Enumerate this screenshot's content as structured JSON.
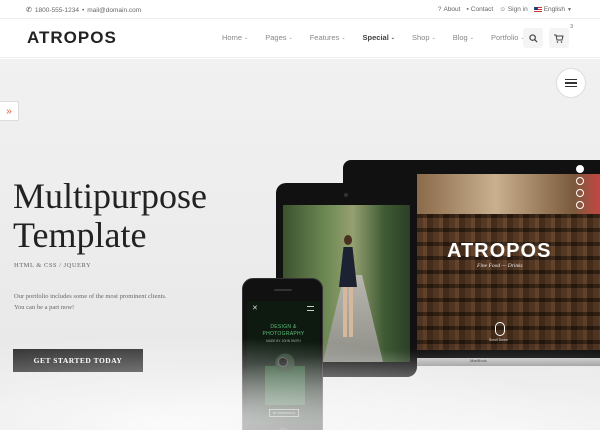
{
  "topbar": {
    "phone": "1800-555-1234",
    "separator": "•",
    "email": "mail@domain.com",
    "links": [
      {
        "label": "About",
        "icon": "question-icon"
      },
      {
        "label": "Contact",
        "icon": "contact-icon"
      },
      {
        "label": "Sign in",
        "icon": "users-icon"
      }
    ],
    "language": "English"
  },
  "header": {
    "logo": "ATROPOS",
    "nav": [
      {
        "label": "Home",
        "active": false
      },
      {
        "label": "Pages",
        "active": false
      },
      {
        "label": "Features",
        "active": false
      },
      {
        "label": "Special",
        "active": true
      },
      {
        "label": "Shop",
        "active": false
      },
      {
        "label": "Blog",
        "active": false
      },
      {
        "label": "Portfolio",
        "active": false
      }
    ],
    "cart_count": "3"
  },
  "hero": {
    "title_line1": "Multipurpose",
    "title_line2": "Template",
    "subtitle": "HTML & CSS / JQUERY",
    "desc_line1": "Our portfolio includes some of the most prominent clients.",
    "desc_line2": "You can be a part now!",
    "cta": "GET STARTED TODAY",
    "slider": {
      "count": 4,
      "active_index": 0
    }
  },
  "devices": {
    "laptop": {
      "brand": "ATROPOS",
      "tagline": "Fine Food — Drinks",
      "scroll_label": "Scroll Down",
      "model": "MacBook"
    },
    "phone": {
      "heading1": "DESIGN &",
      "heading2": "PHOTOGRAPHY",
      "byline": "MADE BY JOHN SMITH",
      "button": "MY PORTFOLIO"
    }
  }
}
